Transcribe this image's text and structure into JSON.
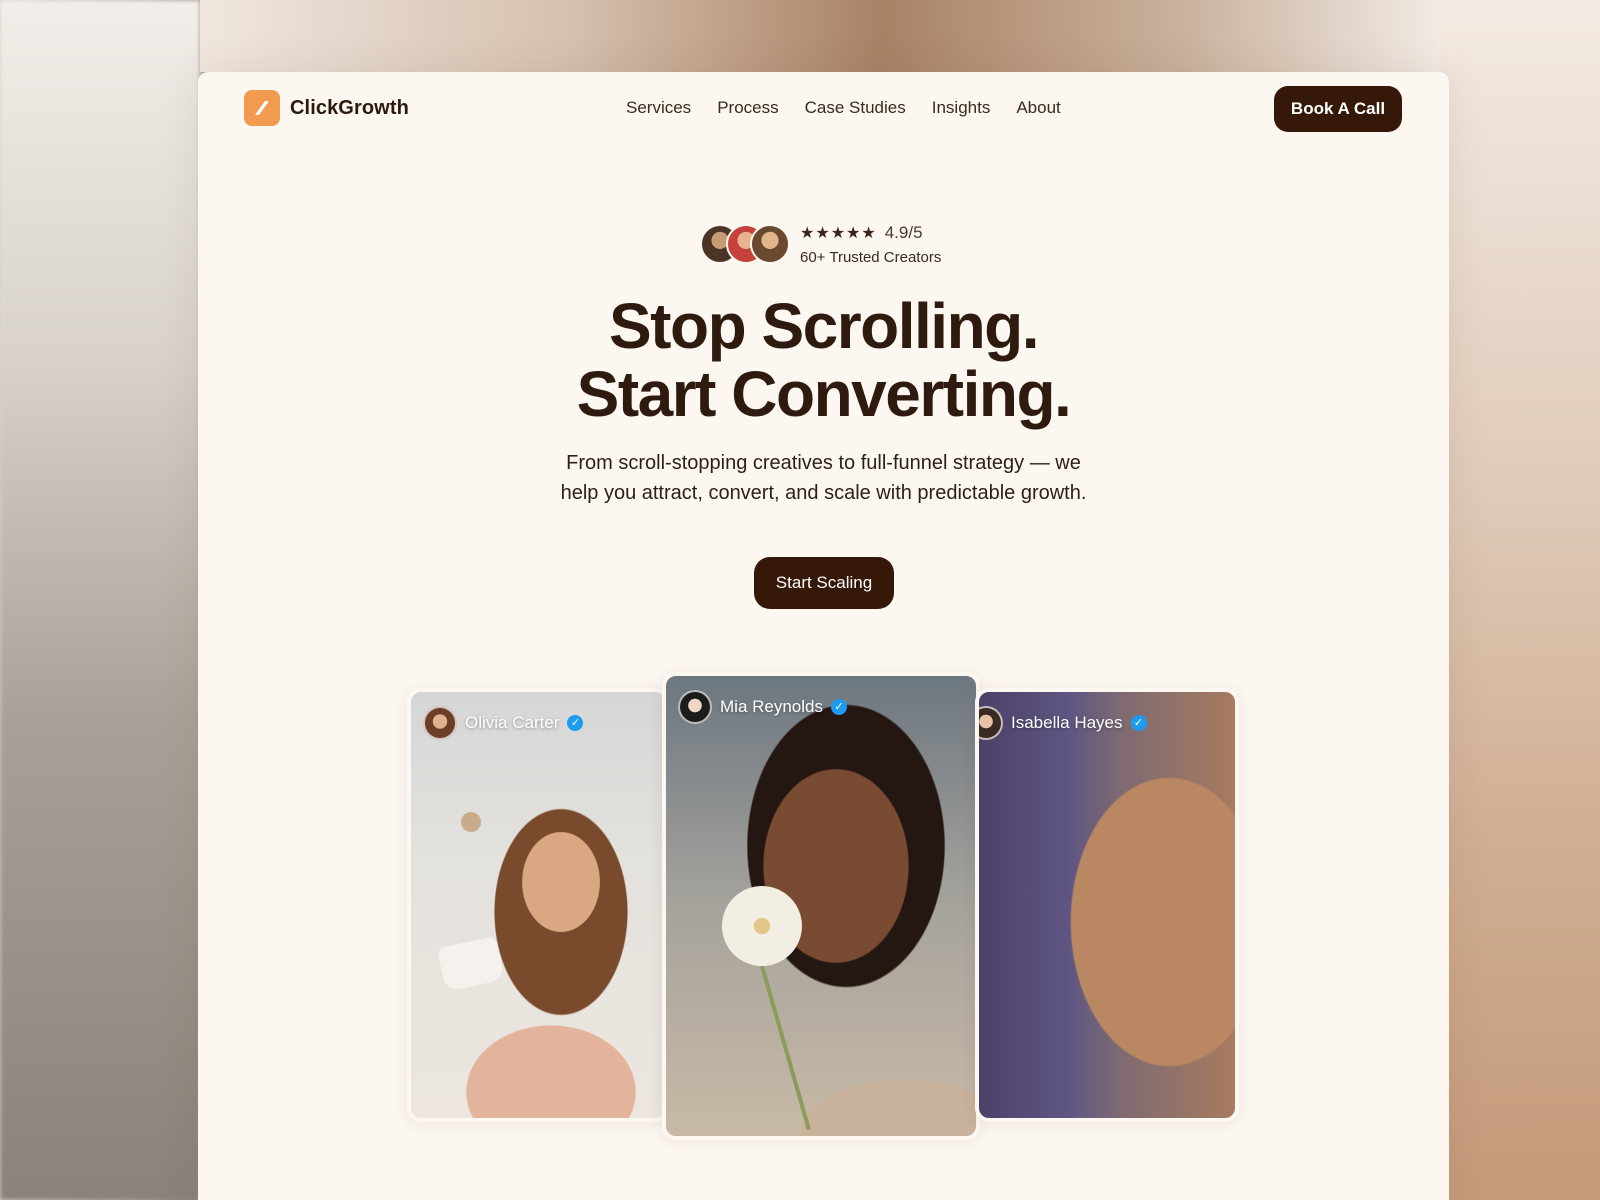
{
  "brand": {
    "name": "ClickGrowth",
    "logo_icon": "slash-mark-icon",
    "accent": "#f29a50"
  },
  "nav": {
    "items": [
      "Services",
      "Process",
      "Case Studies",
      "Insights",
      "About"
    ]
  },
  "header": {
    "cta_label": "Book A Call"
  },
  "trust": {
    "rating": "4.9/5",
    "stars": "★★★★★",
    "caption": "60+ Trusted Creators"
  },
  "hero": {
    "headline_line1": "Stop Scrolling.",
    "headline_line2": "Start Converting.",
    "subtext_line1": "From scroll-stopping creatives to full-funnel strategy — we",
    "subtext_line2": "help you attract, convert, and scale with predictable growth.",
    "cta_label": "Start Scaling"
  },
  "creators": [
    {
      "name": "Olivia Carter",
      "verified": true
    },
    {
      "name": "Mia Reynolds",
      "verified": true
    },
    {
      "name": "Isabella Hayes",
      "verified": true
    }
  ],
  "colors": {
    "primary_dark": "#351808",
    "page_bg": "#fdf7f1",
    "verified_blue": "#1d9bf0"
  }
}
